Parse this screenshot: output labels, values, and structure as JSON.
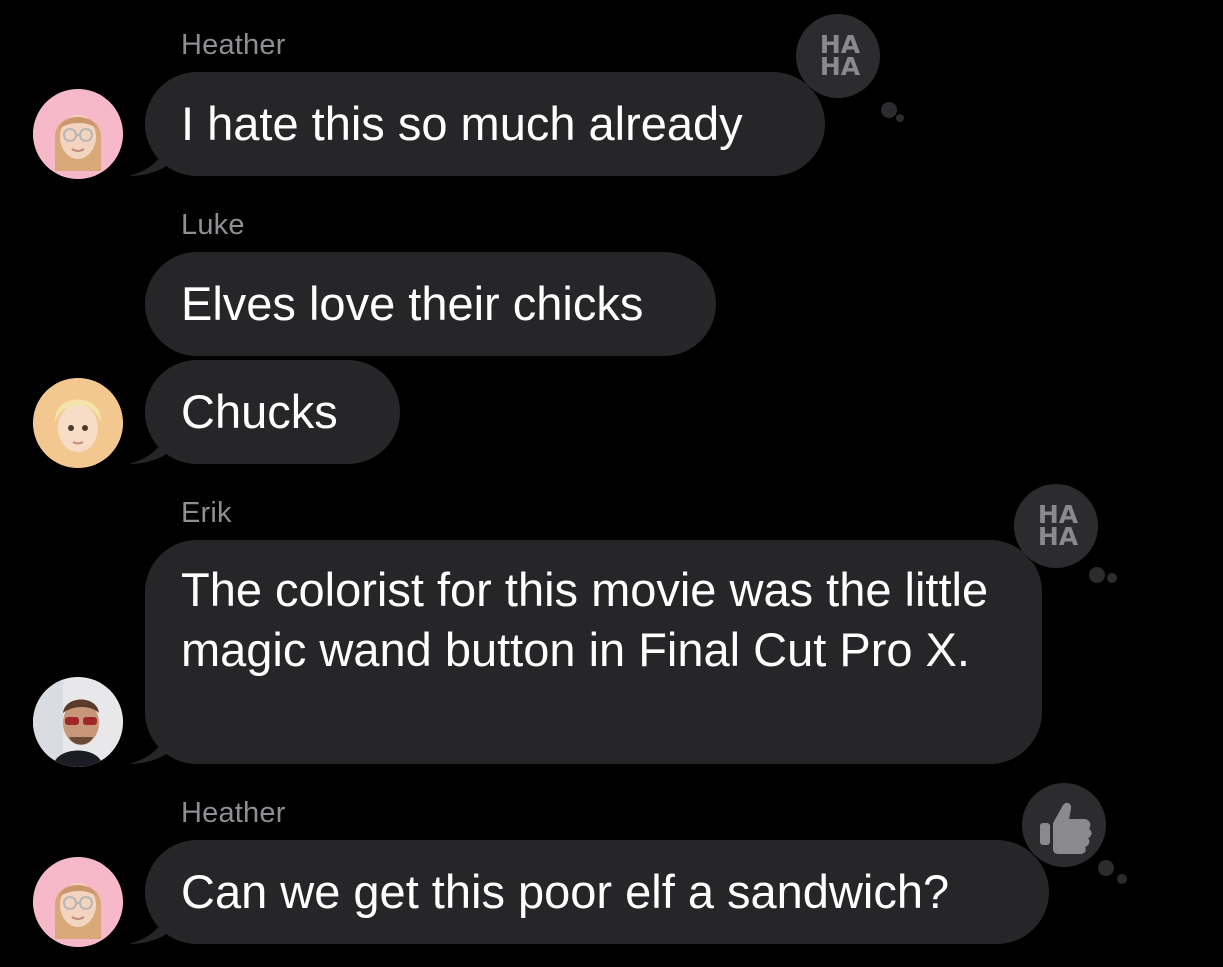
{
  "messages": [
    {
      "sender": "Heather",
      "text": "I hate this so much already",
      "reaction_text": "HA\nHA"
    },
    {
      "sender": "Luke",
      "text": "Elves love their chicks"
    },
    {
      "text": "Chucks"
    },
    {
      "sender": "Erik",
      "text": "The colorist for this movie was the little magic wand button in Final Cut Pro X.",
      "reaction_text": "HA\nHA"
    },
    {
      "sender": "Heather",
      "text": "Can we get this poor elf a sandwich?"
    }
  ],
  "icons": {
    "haha_reaction": "haha-icon",
    "thumbs_up_reaction": "thumbs-up-icon"
  },
  "colors": {
    "background": "#000000",
    "bubble": "#262628",
    "sender_name": "#8e8e93",
    "reaction_bubble": "#2c2c2e"
  }
}
